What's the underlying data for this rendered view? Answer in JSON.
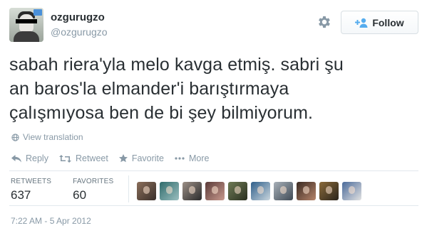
{
  "user": {
    "full_name": "ozgurugzo",
    "screen_name": "@ozgurugzo"
  },
  "follow_button": {
    "label": "Follow"
  },
  "tweet": {
    "lines": [
      "sabah riera'yla melo kavga etmiş. sabri şu",
      "an baros'la elmander'i barıştırmaya",
      "çalışmıyosa ben de bi şey bilmiyorum."
    ]
  },
  "translate": {
    "label": "View translation"
  },
  "actions": [
    {
      "label": "Reply",
      "icon": "reply-icon"
    },
    {
      "label": "Retweet",
      "icon": "retweet-icon"
    },
    {
      "label": "Favorite",
      "icon": "star-icon"
    },
    {
      "label": "More",
      "icon": "more-icon"
    }
  ],
  "stats": {
    "retweets_label": "RETWEETS",
    "retweets_value": "637",
    "favorites_label": "FAVORITES",
    "favorites_value": "60"
  },
  "favoriters": [
    {
      "bg": "#8a6e5a",
      "alt": "#3a2f2a"
    },
    {
      "bg": "#2f6b6b",
      "alt": "#9bbfc0"
    },
    {
      "bg": "#9c8f86",
      "alt": "#2b2b2b"
    },
    {
      "bg": "#5a3a38",
      "alt": "#c99a8e"
    },
    {
      "bg": "#6e7a55",
      "alt": "#2a3020"
    },
    {
      "bg": "#2f5f8a",
      "alt": "#c9d6de"
    },
    {
      "bg": "#a8b0b8",
      "alt": "#3f4a55"
    },
    {
      "bg": "#3a2a22",
      "alt": "#b5846a"
    },
    {
      "bg": "#8a6a3a",
      "alt": "#2a241c"
    },
    {
      "bg": "#4a6a9a",
      "alt": "#e2e2e2"
    }
  ],
  "timestamp": "7:22 AM - 5 Apr 2012",
  "colors": {
    "text": "#292f33",
    "muted": "#8899a6",
    "accent": "#55acee",
    "divider": "#e1e8ed"
  }
}
